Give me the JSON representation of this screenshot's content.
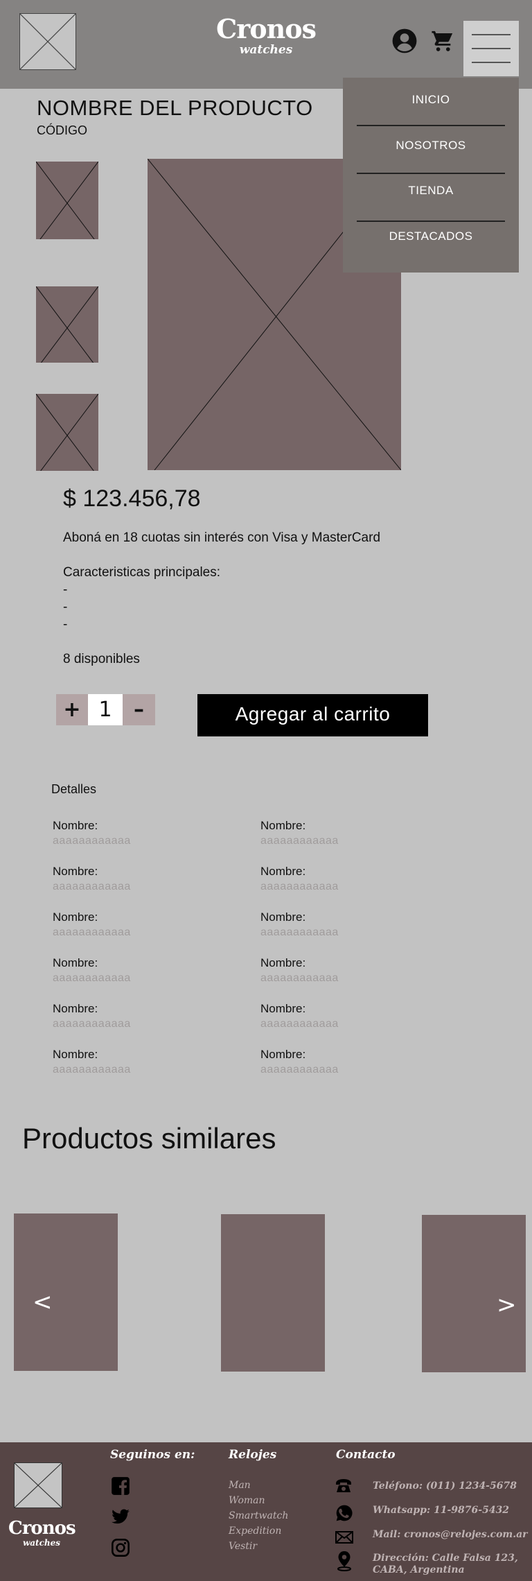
{
  "header": {
    "brand_name": "Cronos",
    "brand_sub": "watches",
    "icons": [
      "user-icon",
      "cart-icon",
      "menu-icon"
    ]
  },
  "menu": {
    "items": [
      {
        "label": "INICIO"
      },
      {
        "label": "NOSOTROS"
      },
      {
        "label": "TIENDA"
      },
      {
        "label": "DESTACADOS"
      }
    ]
  },
  "product": {
    "title": "NOMBRE DEL PRODUCTO",
    "code": "CÓDIGO",
    "price": "$ 123.456,78",
    "installments": "Aboná en 18 cuotas sin interés con Visa y MasterCard",
    "features_title": "Caracteristicas principales:",
    "features": [
      "-",
      "-",
      "-"
    ],
    "stock": "8 disponibles",
    "quantity": "1",
    "plus": "+",
    "minus": "–",
    "add_to_cart": "Agregar al carrito"
  },
  "details": {
    "title": "Detalles",
    "rows": [
      {
        "left_label": "Nombre:",
        "left_value": "aaaaaaaaaaaa",
        "right_label": "Nombre:",
        "right_value": "aaaaaaaaaaaa"
      },
      {
        "left_label": "Nombre:",
        "left_value": "aaaaaaaaaaaa",
        "right_label": "Nombre:",
        "right_value": "aaaaaaaaaaaa"
      },
      {
        "left_label": "Nombre:",
        "left_value": "aaaaaaaaaaaa",
        "right_label": "Nombre:",
        "right_value": "aaaaaaaaaaaa"
      },
      {
        "left_label": "Nombre:",
        "left_value": "aaaaaaaaaaaa",
        "right_label": "Nombre:",
        "right_value": "aaaaaaaaaaaa"
      },
      {
        "left_label": "Nombre:",
        "left_value": "aaaaaaaaaaaa",
        "right_label": "Nombre:",
        "right_value": "aaaaaaaaaaaa"
      },
      {
        "left_label": "Nombre:",
        "left_value": "aaaaaaaaaaaa",
        "right_label": "Nombre:",
        "right_value": "aaaaaaaaaaaa"
      }
    ]
  },
  "similar": {
    "title": "Productos similares",
    "prev": "<",
    "next": ">"
  },
  "footer": {
    "brand_name": "Cronos",
    "brand_sub": "watches",
    "social_title": "Seguinos en:",
    "social_icons": [
      "facebook-icon",
      "twitter-icon",
      "instagram-icon"
    ],
    "watches_title": "Relojes",
    "watches_links": [
      "Man",
      "Woman",
      "Smartwatch",
      "Expedition",
      "Vestir"
    ],
    "contact_title": "Contacto",
    "contact": [
      {
        "icon": "phone-icon",
        "text": "Teléfono: (011) 1234-5678"
      },
      {
        "icon": "whatsapp-icon",
        "text": "Whatsapp: 11-9876-5432"
      },
      {
        "icon": "mail-icon",
        "text": "Mail: cronos@relojes.com.ar"
      },
      {
        "icon": "location-icon",
        "text": "Dirección: Calle Falsa 123, CABA, Argentina"
      }
    ]
  },
  "colors": {
    "header_bg": "#858382",
    "page_bg": "#c2c2c2",
    "menu_bg": "#76706d",
    "image_placeholder": "#766566",
    "stepper_bg": "#b3a4a5",
    "footer_bg": "#564545"
  }
}
